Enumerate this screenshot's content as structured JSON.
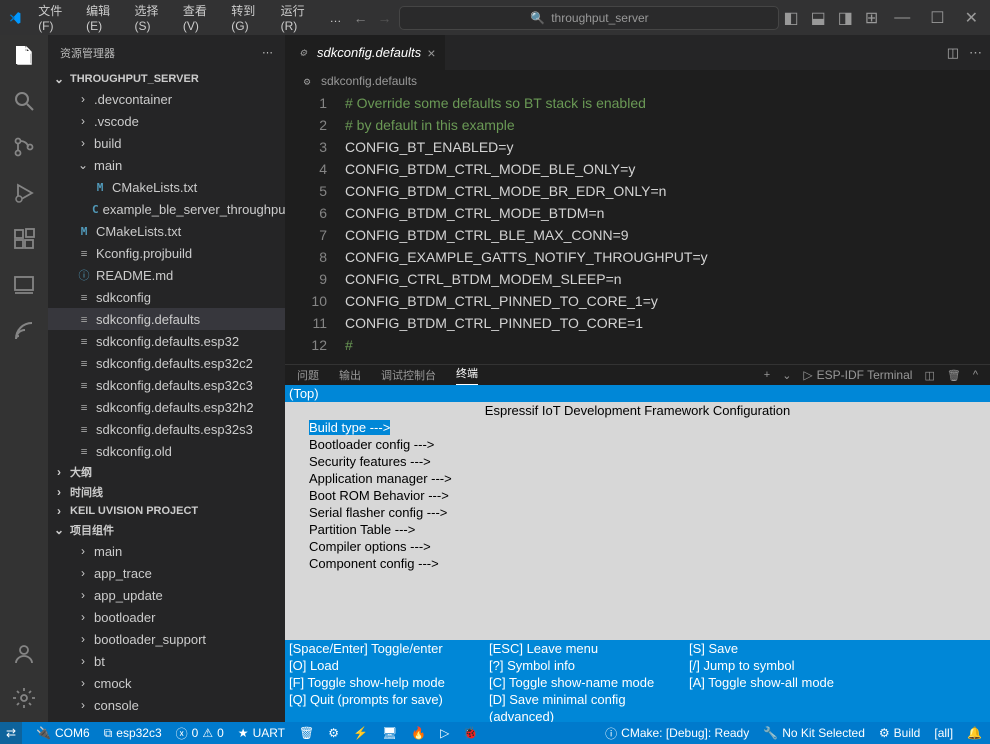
{
  "menu": [
    "文件(F)",
    "编辑(E)",
    "选择(S)",
    "查看(V)",
    "转到(G)",
    "运行(R)",
    "…"
  ],
  "search_placeholder": "throughput_server",
  "explorer_title": "资源管理器",
  "project_name": "THROUGHPUT_SERVER",
  "tree": {
    "folders_top": [
      ".devcontainer",
      ".vscode",
      "build"
    ],
    "main_folder": "main",
    "main_files": [
      {
        "icon": "M",
        "name": "CMakeLists.txt"
      },
      {
        "icon": "C",
        "name": "example_ble_server_throughput.c"
      }
    ],
    "root_files": [
      {
        "icon": "M",
        "name": "CMakeLists.txt"
      },
      {
        "icon": "gear",
        "name": "Kconfig.projbuild"
      },
      {
        "icon": "info",
        "name": "README.md"
      },
      {
        "icon": "gear",
        "name": "sdkconfig"
      },
      {
        "icon": "gear",
        "name": "sdkconfig.defaults",
        "selected": true
      },
      {
        "icon": "gear",
        "name": "sdkconfig.defaults.esp32"
      },
      {
        "icon": "gear",
        "name": "sdkconfig.defaults.esp32c2"
      },
      {
        "icon": "gear",
        "name": "sdkconfig.defaults.esp32c3"
      },
      {
        "icon": "gear",
        "name": "sdkconfig.defaults.esp32h2"
      },
      {
        "icon": "gear",
        "name": "sdkconfig.defaults.esp32s3"
      },
      {
        "icon": "gear",
        "name": "sdkconfig.old"
      }
    ],
    "sections": [
      "大纲",
      "时间线",
      "KEIL UVISION PROJECT"
    ],
    "proj_components_label": "项目组件",
    "proj_components": [
      "main",
      "app_trace",
      "app_update",
      "bootloader",
      "bootloader_support",
      "bt",
      "cmock",
      "console"
    ]
  },
  "tab": {
    "icon": "gear",
    "name": "sdkconfig.defaults"
  },
  "breadcrumb": "sdkconfig.defaults",
  "code_lines": [
    "# Override some defaults so BT stack is enabled",
    "# by default in this example",
    "CONFIG_BT_ENABLED=y",
    "CONFIG_BTDM_CTRL_MODE_BLE_ONLY=y",
    "CONFIG_BTDM_CTRL_MODE_BR_EDR_ONLY=n",
    "CONFIG_BTDM_CTRL_MODE_BTDM=n",
    "CONFIG_BTDM_CTRL_BLE_MAX_CONN=9",
    "CONFIG_EXAMPLE_GATTS_NOTIFY_THROUGHPUT=y",
    "CONFIG_CTRL_BTDM_MODEM_SLEEP=n",
    "CONFIG_BTDM_CTRL_PINNED_TO_CORE_1=y",
    "CONFIG_BTDM_CTRL_PINNED_TO_CORE=1",
    "#"
  ],
  "panel_tabs": [
    "问题",
    "输出",
    "调试控制台",
    "终端"
  ],
  "panel_active": 3,
  "terminal_label": "ESP-IDF Terminal",
  "terminal": {
    "top": "(Top)",
    "title": "Espressif IoT Development Framework Configuration",
    "sel": "Build type  --->",
    "items": [
      "Bootloader config  --->",
      "Security features  --->",
      "Application manager  --->",
      "Boot ROM Behavior  --->",
      "Serial flasher config  --->",
      "Partition Table  --->",
      "Compiler options  --->",
      "Component config  --->"
    ],
    "help": [
      [
        "[Space/Enter] Toggle/enter",
        "[ESC] Leave menu",
        "[S] Save"
      ],
      [
        "[O] Load",
        "[?] Symbol info",
        "[/] Jump to symbol"
      ],
      [
        "[F] Toggle show-help mode",
        "[C] Toggle show-name mode",
        "[A] Toggle show-all mode"
      ],
      [
        "[Q] Quit (prompts for save)",
        "[D] Save minimal config (advanced)",
        ""
      ]
    ]
  },
  "status": {
    "remote": "",
    "port": "COM6",
    "chip": "esp32c3",
    "errors": "0",
    "warnings": "0",
    "uart": "UART",
    "cmake": "CMake: [Debug]: Ready",
    "kit": "No Kit Selected",
    "build": "Build",
    "target": "[all]"
  }
}
